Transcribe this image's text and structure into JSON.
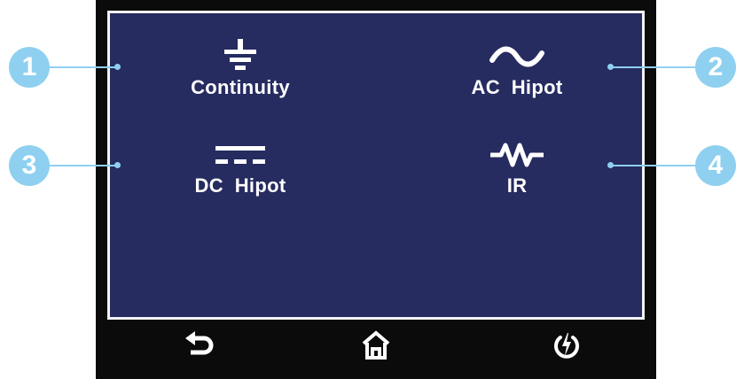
{
  "menu": {
    "items": [
      {
        "label": "Continuity",
        "icon": "ground-icon",
        "callout": "1"
      },
      {
        "label": "AC  Hipot",
        "icon": "ac-sine-icon",
        "callout": "2"
      },
      {
        "label": "DC  Hipot",
        "icon": "dc-icon",
        "callout": "3"
      },
      {
        "label": "IR",
        "icon": "resistor-icon",
        "callout": "4"
      }
    ]
  },
  "bottom_bar": {
    "buttons": [
      {
        "icon": "back-arrow-icon"
      },
      {
        "icon": "home-icon"
      },
      {
        "icon": "start-power-icon"
      }
    ]
  },
  "colors": {
    "screen_bg": "#262b60",
    "callout": "#8fd0f0",
    "device_bezel": "#0b0b0b"
  }
}
